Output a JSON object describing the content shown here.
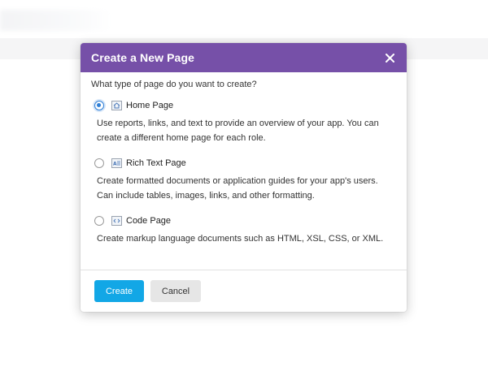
{
  "modal": {
    "title": "Create a New Page",
    "question": "What type of page do you want to create?",
    "options": [
      {
        "label": "Home Page",
        "icon": "home-page-icon",
        "selected": true,
        "description": "Use reports, links, and text to provide an overview of your app. You can create a different home page for each role."
      },
      {
        "label": "Rich Text Page",
        "icon": "rich-text-page-icon",
        "selected": false,
        "description": "Create formatted documents or application guides for your app's users. Can include tables, images, links, and other formatting."
      },
      {
        "label": "Code Page",
        "icon": "code-page-icon",
        "selected": false,
        "description": "Create markup language documents such as HTML, XSL, CSS, or XML."
      }
    ],
    "buttons": {
      "create": "Create",
      "cancel": "Cancel"
    }
  },
  "colors": {
    "header": "#7650a8",
    "primary_button": "#12a7e6",
    "radio_selected": "#2f7fd6"
  }
}
